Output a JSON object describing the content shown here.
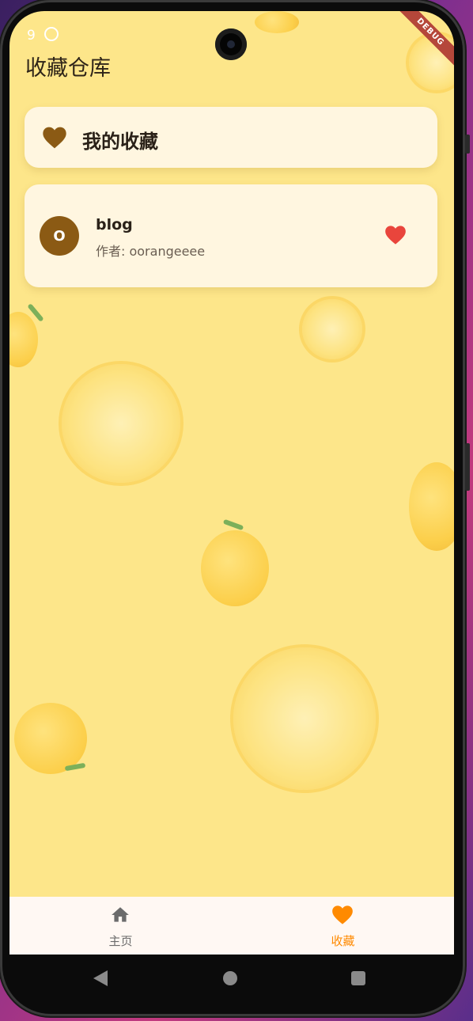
{
  "status_bar": {
    "time": "9"
  },
  "debug_banner": "DEBUG",
  "app_bar": {
    "title": "收藏仓库"
  },
  "header_card": {
    "icon": "heart-icon",
    "title": "我的收藏"
  },
  "favorites": [
    {
      "avatar_letter": "O",
      "title": "blog",
      "subtitle": "作者: oorangeeee",
      "icon": "heart-filled-icon"
    }
  ],
  "bottom_nav": {
    "items": [
      {
        "label": "主页",
        "icon": "home-icon",
        "active": false
      },
      {
        "label": "收藏",
        "icon": "heart-icon",
        "active": true
      }
    ]
  },
  "system_nav": {
    "back": "back-triangle-icon",
    "home": "home-circle-icon",
    "recents": "recents-square-icon"
  },
  "colors": {
    "background": "#fde68a",
    "card": "#fff8ec",
    "heart_brown": "#8b5a14",
    "heart_red": "#e9453c",
    "active_orange": "#ff8a00",
    "inactive_gray": "#6b6b6b"
  }
}
